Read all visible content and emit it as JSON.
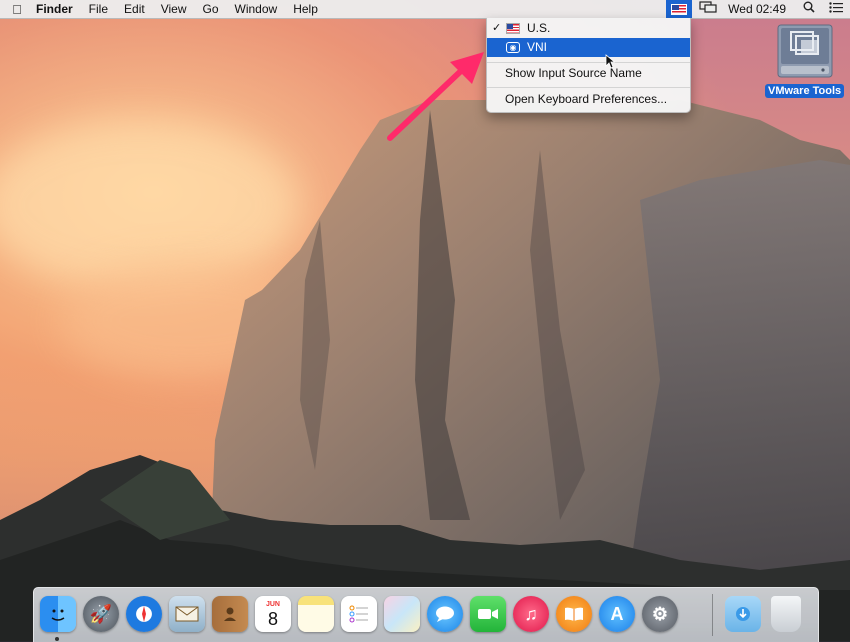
{
  "menubar": {
    "apple_icon": "apple-icon",
    "menus": [
      "Finder",
      "File",
      "Edit",
      "View",
      "Go",
      "Window",
      "Help"
    ],
    "clock": "Wed 02:49",
    "status_icons": [
      "us-flag-icon",
      "display-mirroring-icon",
      "search-icon",
      "notification-center-icon"
    ]
  },
  "input_menu": {
    "items": [
      {
        "label": "U.S.",
        "checked": true,
        "icon": "us-flag-icon"
      },
      {
        "label": "VNI",
        "highlighted": true,
        "icon": "vni-input-icon"
      }
    ],
    "show_input_source_name": "Show Input Source Name",
    "open_keyboard_prefs": "Open Keyboard Preferences..."
  },
  "desktop": {
    "vmware_label": "VMware Tools"
  },
  "dock": {
    "calendar_month": "JUN",
    "calendar_day": "8",
    "apps": [
      "finder",
      "launchpad",
      "safari",
      "mail",
      "contacts",
      "calendar",
      "notes",
      "reminders",
      "photo-booth",
      "messages",
      "facetime",
      "itunes",
      "ibooks",
      "app-store",
      "system-preferences",
      "downloads",
      "trash"
    ]
  },
  "colors": {
    "highlight": "#1a64d0",
    "menubar": "#ececec",
    "annotation_arrow": "#ff2a6a"
  }
}
